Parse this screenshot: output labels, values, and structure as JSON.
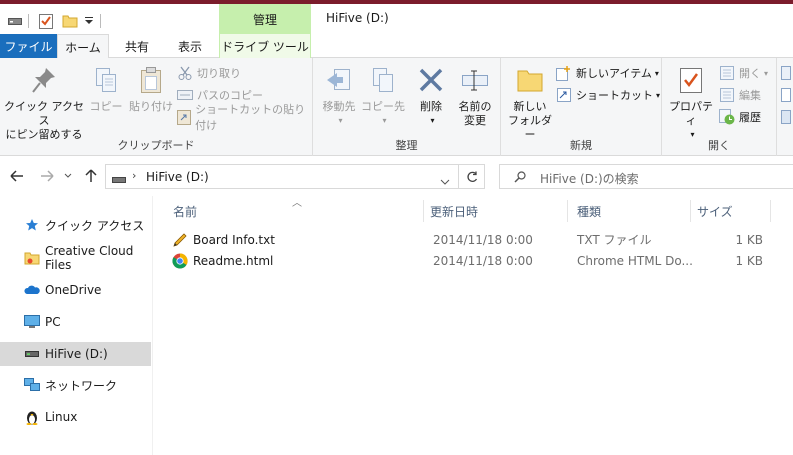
{
  "window": {
    "title": "HiFive (D:)",
    "context_tab_header": "管理"
  },
  "tabs": {
    "file": "ファイル",
    "home": "ホーム",
    "share": "共有",
    "view": "表示",
    "drive_tools": "ドライブ ツール"
  },
  "ribbon": {
    "clipboard": {
      "label": "クリップボード",
      "pin_line1": "クイック アクセス",
      "pin_line2": "にピン留めする",
      "copy": "コピー",
      "paste": "貼り付け",
      "cut": "切り取り",
      "copy_path": "パスのコピー",
      "paste_shortcut": "ショートカットの貼り付け"
    },
    "organize": {
      "label": "整理",
      "move_to": "移動先",
      "copy_to": "コピー先",
      "delete": "削除",
      "rename_line1": "名前の",
      "rename_line2": "変更"
    },
    "new": {
      "label": "新規",
      "new_folder_line1": "新しい",
      "new_folder_line2": "フォルダー",
      "new_item": "新しいアイテム",
      "easy_access": "ショートカット"
    },
    "open": {
      "label": "開く",
      "properties": "プロパティ",
      "open": "開く",
      "edit": "編集",
      "history": "履歴"
    }
  },
  "address": {
    "path": "HiFive (D:)",
    "search_placeholder": "HiFive (D:)の検索"
  },
  "nav": [
    {
      "label": "クイック アクセス",
      "icon": "star-icon"
    },
    {
      "label": "Creative Cloud Files",
      "icon": "creative-cloud-icon"
    },
    {
      "label": "OneDrive",
      "icon": "cloud-icon"
    },
    {
      "label": "PC",
      "icon": "monitor-icon"
    },
    {
      "label": "HiFive (D:)",
      "icon": "drive-icon",
      "selected": true
    },
    {
      "label": "ネットワーク",
      "icon": "network-icon"
    },
    {
      "label": "Linux",
      "icon": "penguin-icon"
    }
  ],
  "columns": {
    "name": "名前",
    "date": "更新日時",
    "type": "種類",
    "size": "サイズ"
  },
  "files": [
    {
      "name": "Board Info.txt",
      "date": "2014/11/18 0:00",
      "type": "TXT ファイル",
      "size": "1 KB",
      "icon": "text-file-icon"
    },
    {
      "name": "Readme.html",
      "date": "2014/11/18 0:00",
      "type": "Chrome HTML Do...",
      "size": "1 KB",
      "icon": "chrome-icon"
    }
  ],
  "colors": {
    "file_tab": "#1a6ebd",
    "context_tab": "#c6efad",
    "selection": "#d9d9d9"
  }
}
